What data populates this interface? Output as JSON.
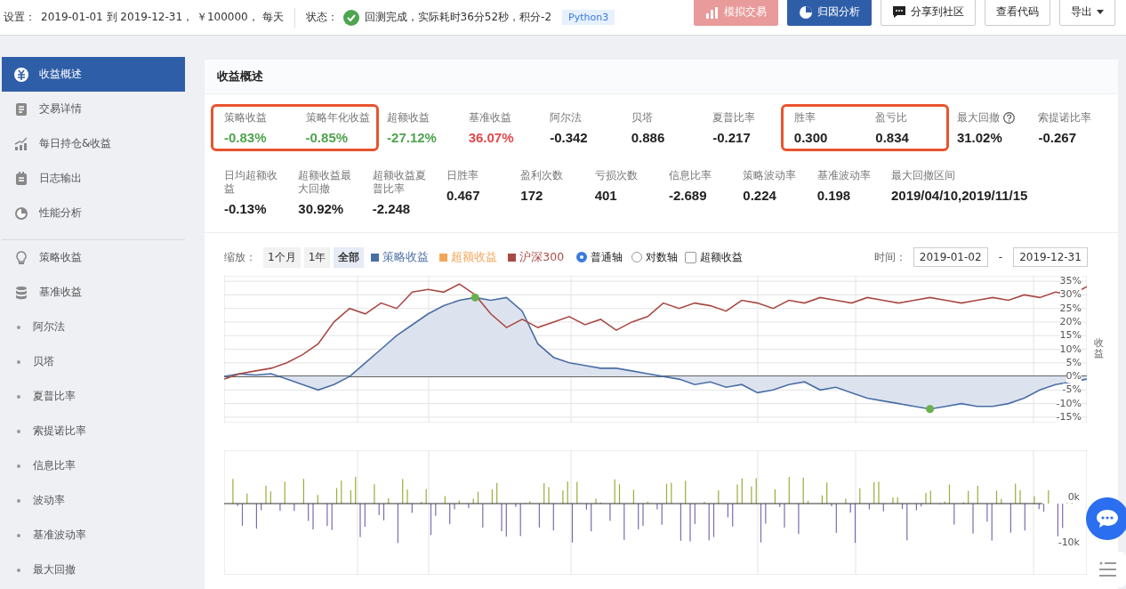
{
  "top_bar": {
    "settings_label": "设置：",
    "settings_value": "2019-01-01 到 2019-12-31， ￥100000， 每天",
    "status_label": "状态：",
    "status_text": "回测完成，实际耗时36分52秒，积分-2",
    "language_tag": "Python3",
    "buttons": [
      {
        "label": "模拟交易",
        "kind": "sim",
        "disabled": true
      },
      {
        "label": "归因分析",
        "kind": "primary",
        "disabled": false
      },
      {
        "label": "分享到社区",
        "kind": "share",
        "disabled": false
      },
      {
        "label": "查看代码",
        "kind": "plain",
        "disabled": false
      },
      {
        "label": "导出",
        "kind": "dropdown",
        "disabled": false
      }
    ]
  },
  "sidebar": {
    "items": [
      {
        "label": "收益概述",
        "kind": "main",
        "selected": true
      },
      {
        "label": "交易详情",
        "kind": "main",
        "selected": false
      },
      {
        "label": "每日持仓&收益",
        "kind": "main",
        "selected": false
      },
      {
        "label": "日志输出",
        "kind": "main",
        "selected": false
      },
      {
        "label": "性能分析",
        "kind": "main",
        "selected": false
      },
      {
        "label": "策略收益",
        "kind": "main",
        "selected": false
      },
      {
        "label": "基准收益",
        "kind": "main",
        "selected": false
      },
      {
        "label": "阿尔法",
        "kind": "sub",
        "selected": false
      },
      {
        "label": "贝塔",
        "kind": "sub",
        "selected": false
      },
      {
        "label": "夏普比率",
        "kind": "sub",
        "selected": false
      },
      {
        "label": "索提诺比率",
        "kind": "sub",
        "selected": false
      },
      {
        "label": "信息比率",
        "kind": "sub",
        "selected": false
      },
      {
        "label": "波动率",
        "kind": "sub",
        "selected": false
      },
      {
        "label": "基准波动率",
        "kind": "sub",
        "selected": false
      },
      {
        "label": "最大回撤",
        "kind": "sub",
        "selected": false
      }
    ]
  },
  "overview": {
    "title": "收益概述",
    "rows": [
      [
        {
          "highlighted": true,
          "metrics": [
            {
              "label": "策略收益",
              "value": "-0.83%",
              "color": "#4fa44f"
            },
            {
              "label": "策略年化收益",
              "value": "-0.85%",
              "color": "#4fa44f"
            }
          ]
        },
        {
          "highlighted": false,
          "metrics": [
            {
              "label": "超额收益",
              "value": "-27.12%",
              "color": "#4fa44f"
            },
            {
              "label": "基准收益",
              "value": "36.07%",
              "color": "#e0474c"
            },
            {
              "label": "阿尔法",
              "value": "-0.342",
              "color": "#222222"
            },
            {
              "label": "贝塔",
              "value": "0.886",
              "color": "#222222"
            },
            {
              "label": "夏普比率",
              "value": "-0.217",
              "color": "#222222"
            }
          ]
        },
        {
          "highlighted": true,
          "metrics": [
            {
              "label": "胜率",
              "value": "0.300",
              "color": "#222222"
            },
            {
              "label": "盈亏比",
              "value": "0.834",
              "color": "#222222"
            }
          ]
        },
        {
          "highlighted": false,
          "metrics": [
            {
              "label": "最大回撤",
              "value": "31.02%",
              "color": "#222222",
              "help": true
            },
            {
              "label": "索提诺比率",
              "value": "-0.267",
              "color": "#222222"
            }
          ]
        }
      ],
      [
        {
          "highlighted": false,
          "metrics": [
            {
              "label": "日均超额收益",
              "value": "-0.13%",
              "color": "#222222"
            },
            {
              "label": "超额收益最大回撤",
              "value": "30.92%",
              "color": "#222222"
            },
            {
              "label": "超额收益夏普比率",
              "value": "-2.248",
              "color": "#222222"
            },
            {
              "label": "日胜率",
              "value": "0.467",
              "color": "#222222"
            },
            {
              "label": "盈利次数",
              "value": "172",
              "color": "#222222"
            },
            {
              "label": "亏损次数",
              "value": "401",
              "color": "#222222"
            },
            {
              "label": "信息比率",
              "value": "-2.689",
              "color": "#222222"
            },
            {
              "label": "策略波动率",
              "value": "0.224",
              "color": "#222222"
            },
            {
              "label": "基准波动率",
              "value": "0.198",
              "color": "#222222"
            },
            {
              "label": "最大回撤区间",
              "value": "2019/04/10,2019/11/15",
              "color": "#222222"
            }
          ]
        }
      ]
    ]
  },
  "chart_toolbar": {
    "zoom_label": "缩放：",
    "zoom_options": [
      {
        "label": "1个月",
        "selected": false
      },
      {
        "label": "1年",
        "selected": false
      },
      {
        "label": "全部",
        "selected": true
      }
    ],
    "legend": [
      {
        "label": "策略收益",
        "color": "#4a6fa5"
      },
      {
        "label": "超额收益",
        "color": "#f5a55a"
      },
      {
        "label": "沪深300",
        "color": "#a84a45"
      }
    ],
    "axis_options": [
      {
        "label": "普通轴",
        "selected": true
      },
      {
        "label": "对数轴",
        "selected": false
      }
    ],
    "excess_toggle": {
      "label": "超额收益",
      "checked": false
    },
    "time_label": "时间：",
    "start_date": "2019-01-02",
    "date_separator": "-",
    "end_date": "2019-12-31"
  },
  "chart": {
    "chart_data": {
      "type": "line",
      "ylabel": "收益",
      "ylim": [
        -17,
        37
      ],
      "grid": true,
      "yticks": [
        {
          "value": 35,
          "label": "35%"
        },
        {
          "value": 30,
          "label": "30%"
        },
        {
          "value": 25,
          "label": "25%"
        },
        {
          "value": 20,
          "label": "20%"
        },
        {
          "value": 15,
          "label": "15%"
        },
        {
          "value": 10,
          "label": "10%"
        },
        {
          "value": 5,
          "label": "5%"
        },
        {
          "value": 0,
          "label": "0%"
        },
        {
          "value": -5,
          "label": "-5%"
        },
        {
          "value": -10,
          "label": "-10%"
        },
        {
          "value": -15,
          "label": "-15%"
        }
      ],
      "series": [
        {
          "color": "#4a6fa5",
          "values": [
            0,
            1,
            0.5,
            1,
            -1,
            -3,
            -5,
            -3,
            0,
            5,
            10,
            15,
            19,
            23,
            26,
            28,
            29,
            28,
            29,
            24,
            12,
            7,
            5,
            4,
            3,
            3,
            2,
            1,
            0,
            -1,
            -3,
            -2,
            -4,
            -3,
            -6,
            -5,
            -3,
            -2,
            -5,
            -4,
            -6,
            -8,
            -9,
            -10,
            -11,
            -12,
            -11,
            -10,
            -11,
            -11,
            -10,
            -8,
            -5,
            -3,
            -2,
            -1
          ]
        },
        {
          "color": "#a84a45",
          "values": [
            -1,
            1,
            2,
            3,
            5,
            8,
            12,
            20,
            25,
            23,
            27,
            25,
            31,
            32,
            31,
            34,
            30,
            23,
            18,
            21,
            18,
            20,
            22,
            19,
            21,
            17,
            20,
            22,
            27,
            25,
            27,
            26,
            24,
            28,
            27,
            25,
            28,
            27,
            29,
            28,
            27,
            29,
            28,
            27,
            28,
            29,
            28,
            27,
            28,
            29,
            28,
            30,
            29,
            31,
            30,
            33
          ]
        }
      ]
    }
  },
  "volume_chart": {
    "y_tick_labels": [
      "0k",
      "-10k"
    ]
  }
}
